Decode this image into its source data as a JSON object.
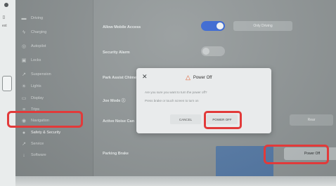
{
  "bezel": {
    "label_top": "[]",
    "label_mid": "ext"
  },
  "sidebar": {
    "items": [
      {
        "icon": "car-icon",
        "glyph": "▬",
        "label": "Driving"
      },
      {
        "icon": "charging-icon",
        "glyph": "ϟ",
        "label": "Charging"
      },
      {
        "icon": "autopilot-icon",
        "glyph": "◎",
        "label": "Autopilot"
      },
      {
        "icon": "locks-icon",
        "glyph": "▣",
        "label": "Locks"
      },
      {
        "icon": "suspension-icon",
        "glyph": "↗",
        "label": "Suspension"
      },
      {
        "icon": "lights-icon",
        "glyph": "☀",
        "label": "Lights"
      },
      {
        "icon": "display-icon",
        "glyph": "▭",
        "label": "Display"
      },
      {
        "icon": "trips-icon",
        "glyph": "≡",
        "label": "Trips"
      },
      {
        "icon": "navigation-icon",
        "glyph": "◉",
        "label": "Navigation"
      },
      {
        "icon": "safety-icon",
        "glyph": "●",
        "label": "Safety & Security"
      },
      {
        "icon": "service-icon",
        "glyph": "↗",
        "label": "Service"
      },
      {
        "icon": "software-icon",
        "glyph": "↓",
        "label": "Software"
      }
    ]
  },
  "settings": {
    "allow_mobile_access": "Allow Mobile Access",
    "security_alarm": "Security Alarm",
    "park_assist_chimes": "Park Assist Chimes",
    "joe_mode": "Joe Mode ⓘ",
    "active_noise_cancel": "Active Noise Can",
    "parking_brake": "Parking Brake",
    "only_driving": "Only Driving",
    "right_option": "Rear",
    "power_off_button": "Power Off"
  },
  "dialog": {
    "close": "✕",
    "title": "Power Off",
    "line1": "Are you sure you want to turn the power off?",
    "line2": "Press brake or touch screen to turn on",
    "cancel": "CANCEL",
    "confirm": "POWER OFF"
  },
  "colors": {
    "callout": "#e23a3a",
    "toggle_on": "#2f5fd0"
  }
}
